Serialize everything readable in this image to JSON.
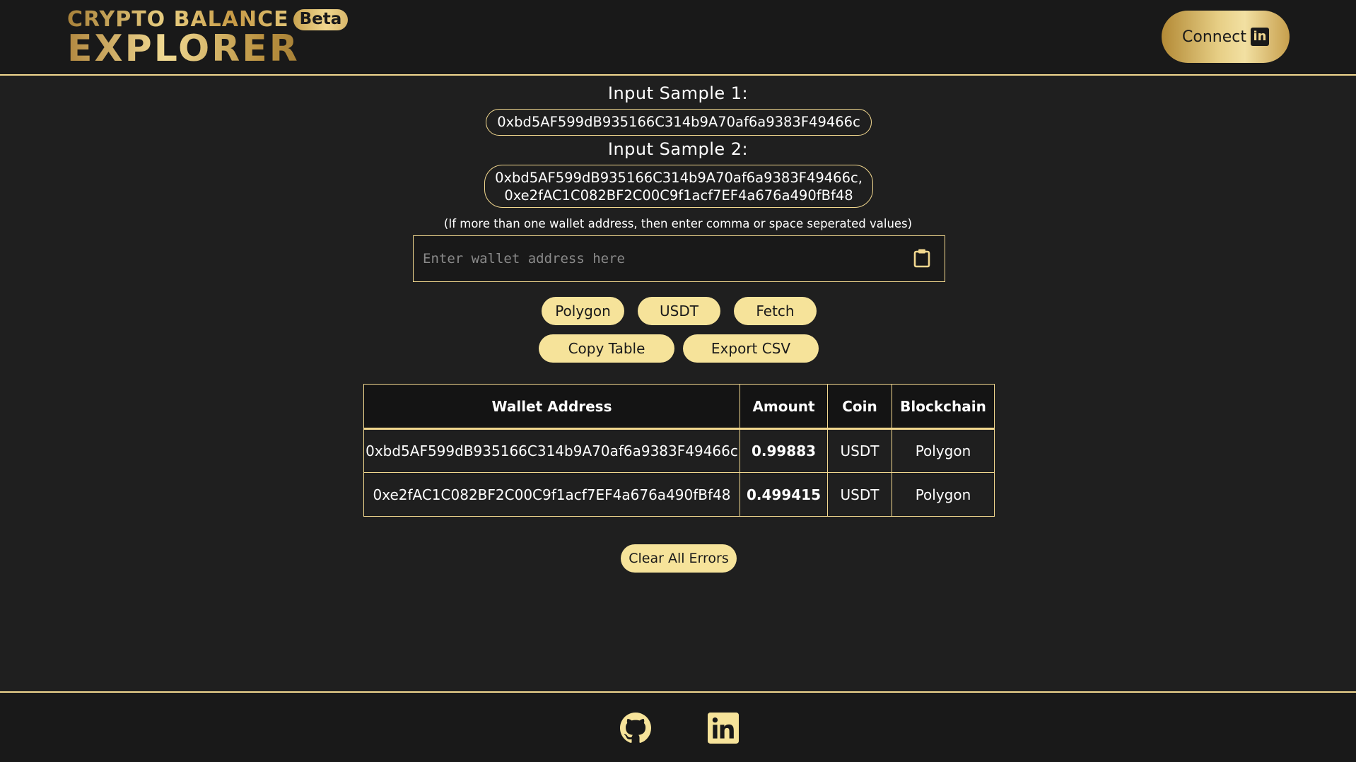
{
  "header": {
    "logo_top": "CRYPTO BALANCE",
    "logo_badge": "Beta",
    "logo_bottom": "EXPLORER",
    "connect_label": "Connect",
    "connect_icon": "linkedin-icon"
  },
  "samples": {
    "sample1_title": "Input Sample 1:",
    "sample1_value": "0xbd5AF599dB935166C314b9A70af6a9383F49466c",
    "sample2_title": "Input Sample 2:",
    "sample2_line1": "0xbd5AF599dB935166C314b9A70af6a9383F49466c,",
    "sample2_line2": "0xe2fAC1C082BF2C00C9f1acf7EF4a676a490fBf48"
  },
  "hint": "(If more than one wallet address, then enter comma or space seperated values)",
  "input": {
    "placeholder": "Enter wallet address here",
    "value": "",
    "icon": "clipboard-icon"
  },
  "buttons": {
    "polygon": "Polygon",
    "usdt": "USDT",
    "fetch": "Fetch",
    "copy_table": "Copy Table",
    "export_csv": "Export CSV",
    "clear_errors": "Clear All Errors"
  },
  "table": {
    "headers": [
      "Wallet Address",
      "Amount",
      "Coin",
      "Blockchain"
    ],
    "rows": [
      {
        "wallet": "0xbd5AF599dB935166C314b9A70af6a9383F49466c",
        "amount": "0.99883",
        "coin": "USDT",
        "blockchain": "Polygon"
      },
      {
        "wallet": "0xe2fAC1C082BF2C00C9f1acf7EF4a676a490fBf48",
        "amount": "0.499415",
        "coin": "USDT",
        "blockchain": "Polygon"
      }
    ]
  },
  "footer": {
    "icons": [
      "github-icon",
      "linkedin-icon"
    ]
  },
  "colors": {
    "background": "#1f1f1f",
    "accent_gold": "#f2d88f",
    "button_fill": "#f6e39a"
  }
}
